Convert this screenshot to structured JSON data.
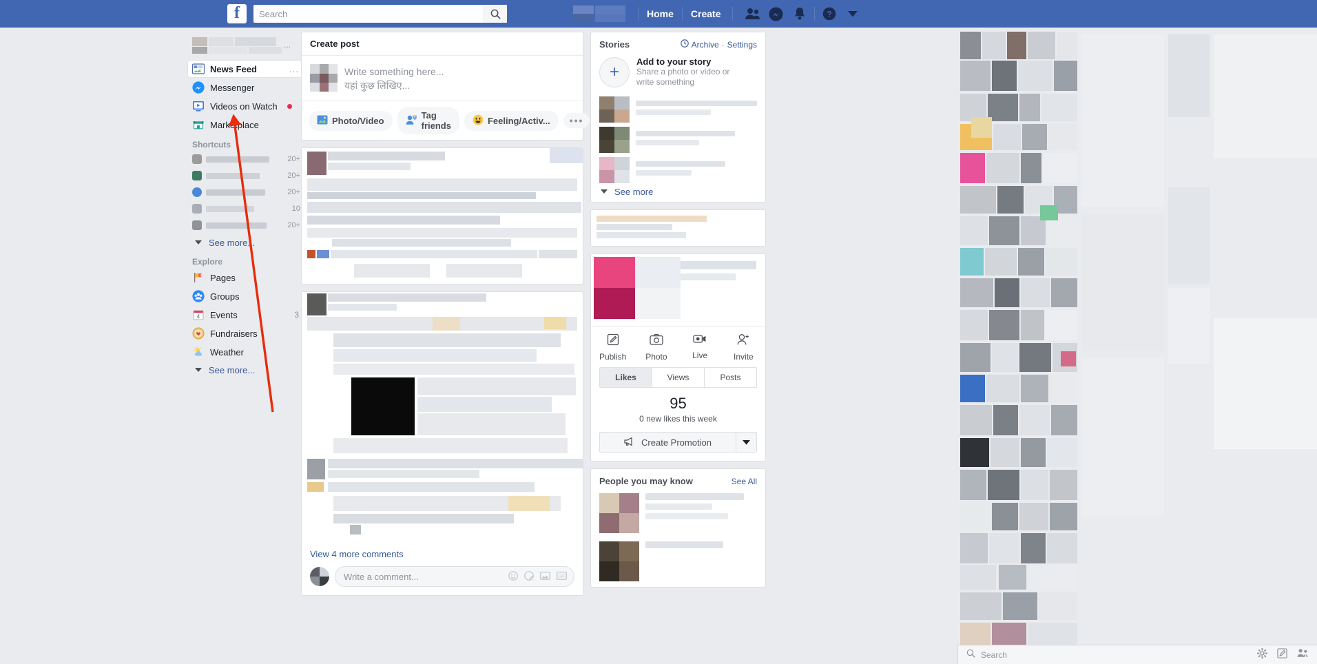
{
  "topbar": {
    "logo": "f",
    "search": {
      "placeholder": "Search",
      "value": "",
      "icon": "search-icon"
    },
    "nav_links": [
      "Home",
      "Create"
    ],
    "icons": [
      "friend-requests-icon",
      "messenger-icon",
      "notifications-icon",
      "help-icon",
      "account-dropdown-icon"
    ]
  },
  "sidebar": {
    "main_items": [
      {
        "label": "News Feed",
        "icon": "news-feed-icon",
        "active": true,
        "menu": "..."
      },
      {
        "label": "Messenger",
        "icon": "messenger-icon",
        "active": false
      },
      {
        "label": "Videos on Watch",
        "icon": "watch-icon",
        "active": false,
        "unread": true
      },
      {
        "label": "Marketplace",
        "icon": "marketplace-icon",
        "active": false
      }
    ],
    "shortcuts_title": "Shortcuts",
    "shortcuts": [
      {
        "count": "20+"
      },
      {
        "count": "20+"
      },
      {
        "count": "20+"
      },
      {
        "count": "10"
      },
      {
        "count": "20+"
      }
    ],
    "shortcuts_see_more": "See more...",
    "explore_title": "Explore",
    "explore": [
      {
        "label": "Pages",
        "icon": "pages-flag-icon",
        "count": ""
      },
      {
        "label": "Groups",
        "icon": "groups-icon",
        "count": ""
      },
      {
        "label": "Events",
        "icon": "events-calendar-icon",
        "count": "3"
      },
      {
        "label": "Fundraisers",
        "icon": "fundraisers-icon",
        "count": ""
      },
      {
        "label": "Weather",
        "icon": "weather-icon",
        "count": ""
      }
    ],
    "explore_see_more": "See more..."
  },
  "composer": {
    "title": "Create post",
    "placeholder_en": "Write something here...",
    "placeholder_hi": "यहां कुछ लिखिए...",
    "actions": [
      {
        "label": "Photo/Video",
        "icon": "photo-video-icon"
      },
      {
        "label": "Tag friends",
        "icon": "tag-friends-icon"
      },
      {
        "label": "Feeling/Activ...",
        "icon": "feeling-activity-icon"
      }
    ],
    "more_label": "•••"
  },
  "feed": {
    "view_more_comments": "View 4 more comments",
    "comment_placeholder": "Write a comment..."
  },
  "stories": {
    "title": "Stories",
    "archive_label": "Archive",
    "separator": "·",
    "settings_label": "Settings",
    "add_title": "Add to your story",
    "add_subtitle": "Share a photo or video or write something",
    "see_more": "See more",
    "plus": "+"
  },
  "page_panel": {
    "actions": [
      {
        "label": "Publish",
        "icon": "publish-pencil-icon"
      },
      {
        "label": "Photo",
        "icon": "camera-icon"
      },
      {
        "label": "Live",
        "icon": "live-video-icon"
      },
      {
        "label": "Invite",
        "icon": "invite-person-icon"
      }
    ],
    "tabs": [
      {
        "label": "Likes",
        "selected": true
      },
      {
        "label": "Views",
        "selected": false
      },
      {
        "label": "Posts",
        "selected": false
      }
    ],
    "stat_value": "95",
    "stat_caption": "0 new likes this week",
    "promotion_label": "Create Promotion",
    "promotion_icon": "megaphone-icon"
  },
  "pymk": {
    "title": "People you may know",
    "see_all": "See All"
  },
  "chatbar": {
    "search_placeholder": "Search",
    "icons": [
      "gear-icon",
      "compose-message-icon",
      "new-group-icon"
    ]
  },
  "annotation": {
    "type": "arrow",
    "color": "#e82c0c",
    "points_to": "Marketplace"
  },
  "colors": {
    "brand_blue": "#4267b2",
    "link_blue": "#385898",
    "page_bg": "#e9ebee",
    "card_bg": "#ffffff",
    "accent_red": "#f02849"
  }
}
